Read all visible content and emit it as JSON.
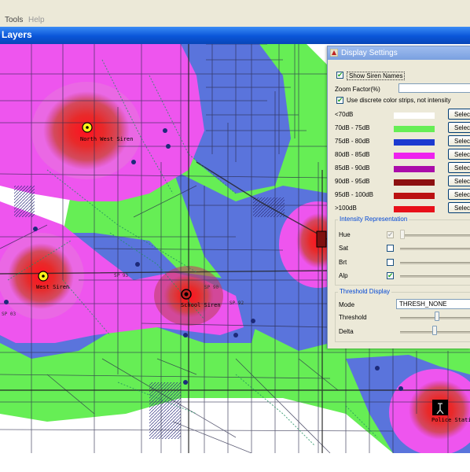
{
  "window": {
    "menu": [
      "Tools",
      "Help"
    ],
    "title": "Layers"
  },
  "dialog": {
    "title": "Display Settings",
    "show_names_label": "Show Siren Names",
    "show_names_checked": true,
    "zoom_label": "Zoom Factor(%)",
    "discrete_label": "Use discrete color strips, not intensity",
    "discrete_checked": true,
    "select_label": "Select",
    "strips": [
      {
        "label": "<70dB",
        "color": "#ffffff"
      },
      {
        "label": "70dB - 75dB",
        "color": "#66ee55"
      },
      {
        "label": "75dB - 80dB",
        "color": "#1c3ad0"
      },
      {
        "label": "80dB - 85dB",
        "color": "#ee22ee"
      },
      {
        "label": "85dB - 90dB",
        "color": "#aa0caa"
      },
      {
        "label": "90dB - 95dB",
        "color": "#8c1010"
      },
      {
        "label": "95dB - 100dB",
        "color": "#bb1111"
      },
      {
        "label": ">100dB",
        "color": "#e8101a"
      }
    ],
    "intensity": {
      "title": "Intensity Representation",
      "rows": [
        {
          "label": "Hue",
          "checked": true,
          "enabled": false
        },
        {
          "label": "Sat",
          "checked": false,
          "enabled": true
        },
        {
          "label": "Brt",
          "checked": false,
          "enabled": true
        },
        {
          "label": "Alp",
          "checked": true,
          "enabled": true
        }
      ]
    },
    "threshold": {
      "title": "Threshold Display",
      "mode_label": "Mode",
      "mode_value": "THRESH_NONE",
      "threshold_label": "Threshold",
      "delta_label": "Delta"
    }
  },
  "map": {
    "sirens": [
      {
        "name": "North West Siren",
        "icon": "siren-yellow-icon"
      },
      {
        "name": "West Siren",
        "icon": "siren-yellow-icon"
      },
      {
        "name": "School Siren",
        "icon": "siren-dark-icon"
      },
      {
        "name": "Police Station",
        "icon": "siren-dark-icon"
      }
    ],
    "road_labels": [
      "SP 03",
      "SP 93",
      "SP 92",
      "SP 90"
    ],
    "zone_colors": {
      "green": "#66ee55",
      "blue": "#5a74dc",
      "magenta": "#ee55ee",
      "red_core": "#e0202a"
    }
  }
}
